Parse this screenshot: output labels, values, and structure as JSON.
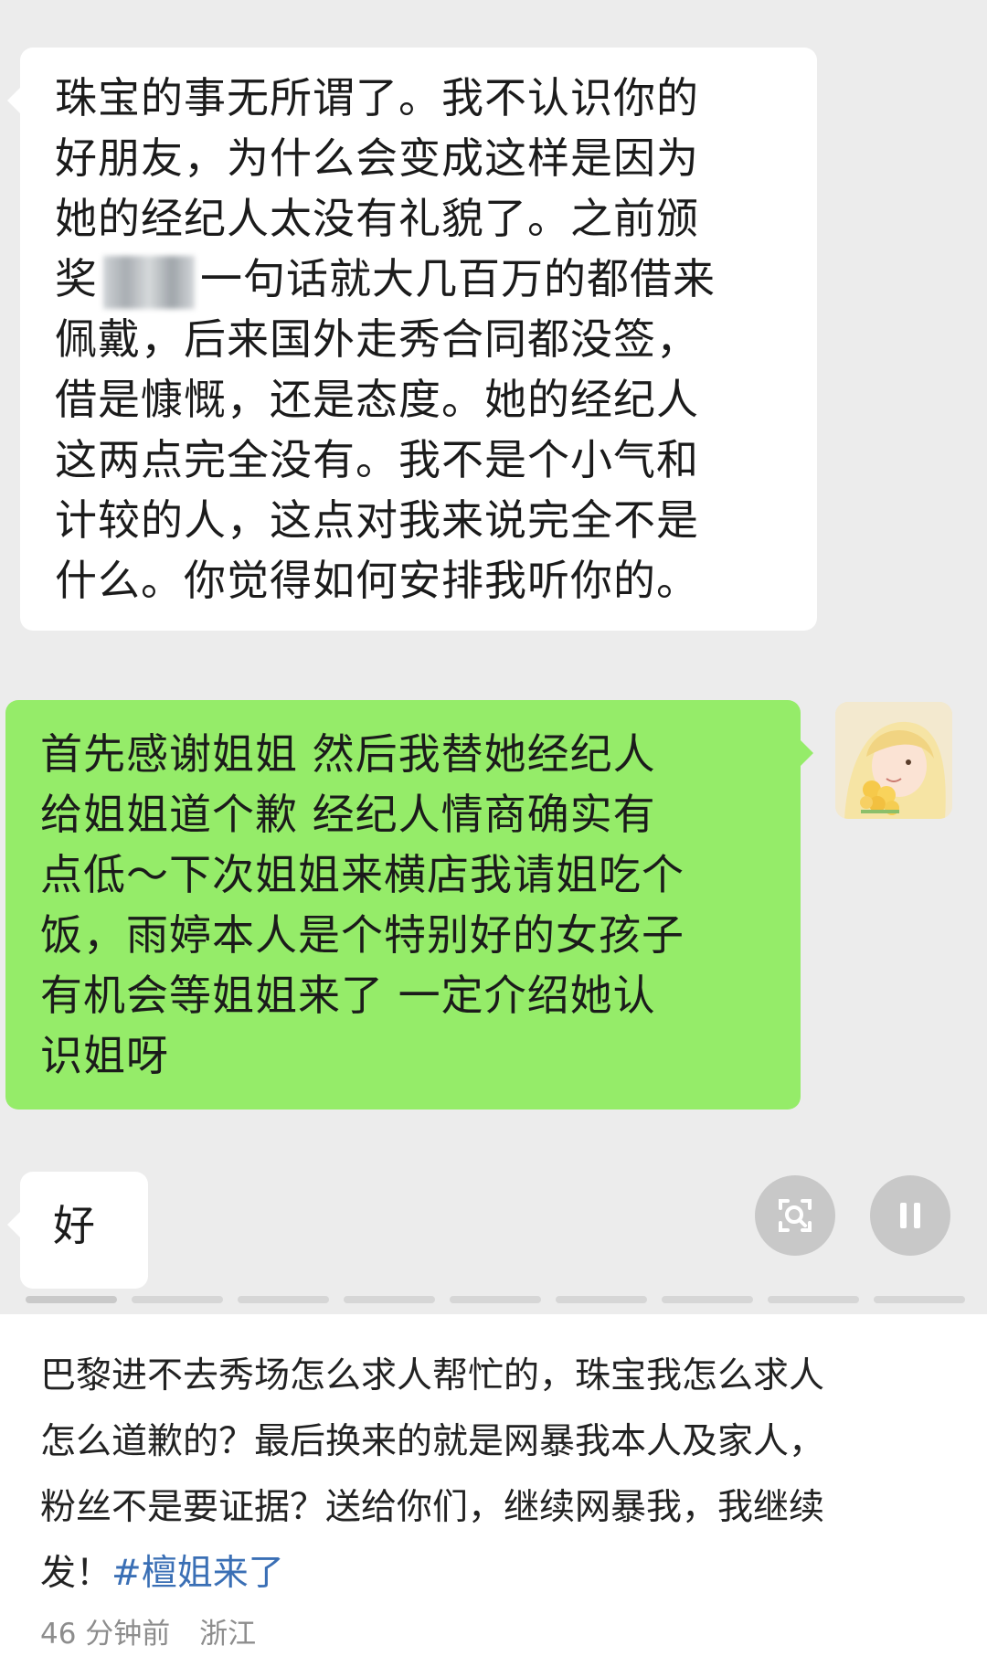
{
  "chat": {
    "messages": [
      {
        "side": "left",
        "lines": [
          "珠宝的事无所谓了。我不认识你的",
          "好朋友，为什么会变成这样是因为",
          "她的经纪人太没有礼貌了。之前颁",
          "一句话就大几百万的都借来",
          "佩戴，后来国外走秀合同都没签，",
          "借是慷慨，还是态度。她的经纪人",
          "这两点完全没有。我不是个小气和",
          "计较的人，这点对我来说完全不是",
          "什么。你觉得如何安排我听你的。"
        ],
        "line4_prefix": "奖"
      },
      {
        "side": "right",
        "lines": [
          "首先感谢姐姐 然后我替她经纪人",
          "给姐姐道个歉 经纪人情商确实有",
          "点低～下次姐姐来横店我请姐吃个",
          "饭，雨婷本人是个特别好的女孩子",
          "有机会等姐姐来了 一定介绍她认",
          "识姐呀"
        ]
      },
      {
        "side": "left",
        "lines": [
          "好"
        ]
      }
    ]
  },
  "caption": {
    "lines": [
      "巴黎进不去秀场怎么求人帮忙的，珠宝我怎么求人",
      "怎么道歉的？最后换来的就是网暴我本人及家人，",
      "粉丝不是要证据？送给你们，继续网暴我，我继续"
    ],
    "last_prefix": "发！",
    "hashtag": "#檀姐来了"
  },
  "meta": {
    "time": "46 分钟前",
    "location": "浙江"
  },
  "icons": [
    "scan-icon",
    "pause-icon",
    "avatar"
  ]
}
